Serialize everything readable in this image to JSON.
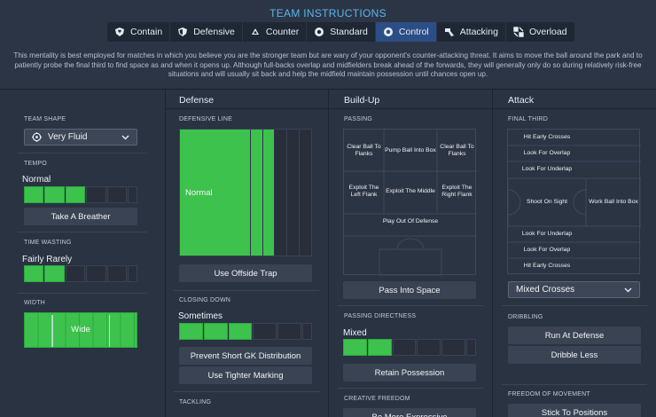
{
  "header": {
    "title": "TEAM INSTRUCTIONS",
    "tabs": [
      {
        "label": "Contain",
        "icon": "shield-heart-icon",
        "active": false
      },
      {
        "label": "Defensive",
        "icon": "shield-icon",
        "active": false
      },
      {
        "label": "Counter",
        "icon": "counter-arrows-icon",
        "active": false
      },
      {
        "label": "Standard",
        "icon": "standard-gear-icon",
        "active": false
      },
      {
        "label": "Control",
        "icon": "control-ball-icon",
        "active": true
      },
      {
        "label": "Attacking",
        "icon": "attacking-arrow-icon",
        "active": false
      },
      {
        "label": "Overload",
        "icon": "overload-icon",
        "active": false
      }
    ],
    "description": "This mentality is best employed for matches in which you believe you are the stronger team but are wary of your opponent's counter-attacking threat. It aims to move the ball around the park and to patiently probe the final third to find space as and when it opens up. Although full-backs overlap and midfielders break ahead of the forwards, they will generally only do so during relatively risk-free situations and will usually sit back and help the midfield maintain possession until chances open up."
  },
  "team_shape": {
    "label": "TEAM SHAPE",
    "value": "Very Fluid"
  },
  "tempo": {
    "label": "TEMPO",
    "value": "Normal",
    "level": 3,
    "segments": 5,
    "button": "Take A Breather"
  },
  "time_wasting": {
    "label": "TIME WASTING",
    "value": "Fairly Rarely",
    "level": 2,
    "segments": 5
  },
  "width": {
    "label": "WIDTH",
    "value": "Wide"
  },
  "defense": {
    "title": "Defense",
    "defensive_line": {
      "label": "DEFENSIVE LINE",
      "value": "Normal",
      "button": "Use Offside Trap"
    },
    "closing_down": {
      "label": "CLOSING DOWN",
      "value": "Sometimes",
      "level": 3,
      "segments": 5
    },
    "buttons": [
      "Prevent Short GK Distribution",
      "Use Tighter Marking"
    ],
    "tackling": {
      "label": "TACKLING"
    }
  },
  "buildup": {
    "title": "Build-Up",
    "passing": {
      "label": "PASSING",
      "cells": [
        "Clear Ball To Flanks",
        "Pump Ball Into Box",
        "Clear Ball To Flanks",
        "Exploit The Left Flank",
        "Exploit The Middle",
        "Exploit The Right Flank",
        "Play Out Of Defense"
      ],
      "button": "Pass Into Space"
    },
    "directness": {
      "label": "PASSING DIRECTNESS",
      "value": "Mixed",
      "level": 2,
      "segments": 5,
      "button": "Retain Possession"
    },
    "creative": {
      "label": "CREATIVE FREEDOM",
      "button": "Be More Expressive"
    }
  },
  "attack": {
    "title": "Attack",
    "final_third": {
      "label": "FINAL THIRD",
      "cells": [
        "Hit Early Crosses",
        "Look For Overlap",
        "Look For Underlap",
        "Shoot On Sight",
        "Work Ball Into Box",
        "Look For Underlap",
        "Look For Overlap",
        "Hit Early Crosses"
      ],
      "dropdown": "Mixed Crosses"
    },
    "dribbling": {
      "label": "DRIBBLING",
      "buttons": [
        "Run At Defense",
        "Dribble Less"
      ]
    },
    "freedom": {
      "label": "FREEDOM OF MOVEMENT",
      "button": "Stick To Positions"
    }
  },
  "colors": {
    "accent": "#59b6ee",
    "active_tab": "#2c4e86",
    "slider_on": "#3dc24e"
  }
}
